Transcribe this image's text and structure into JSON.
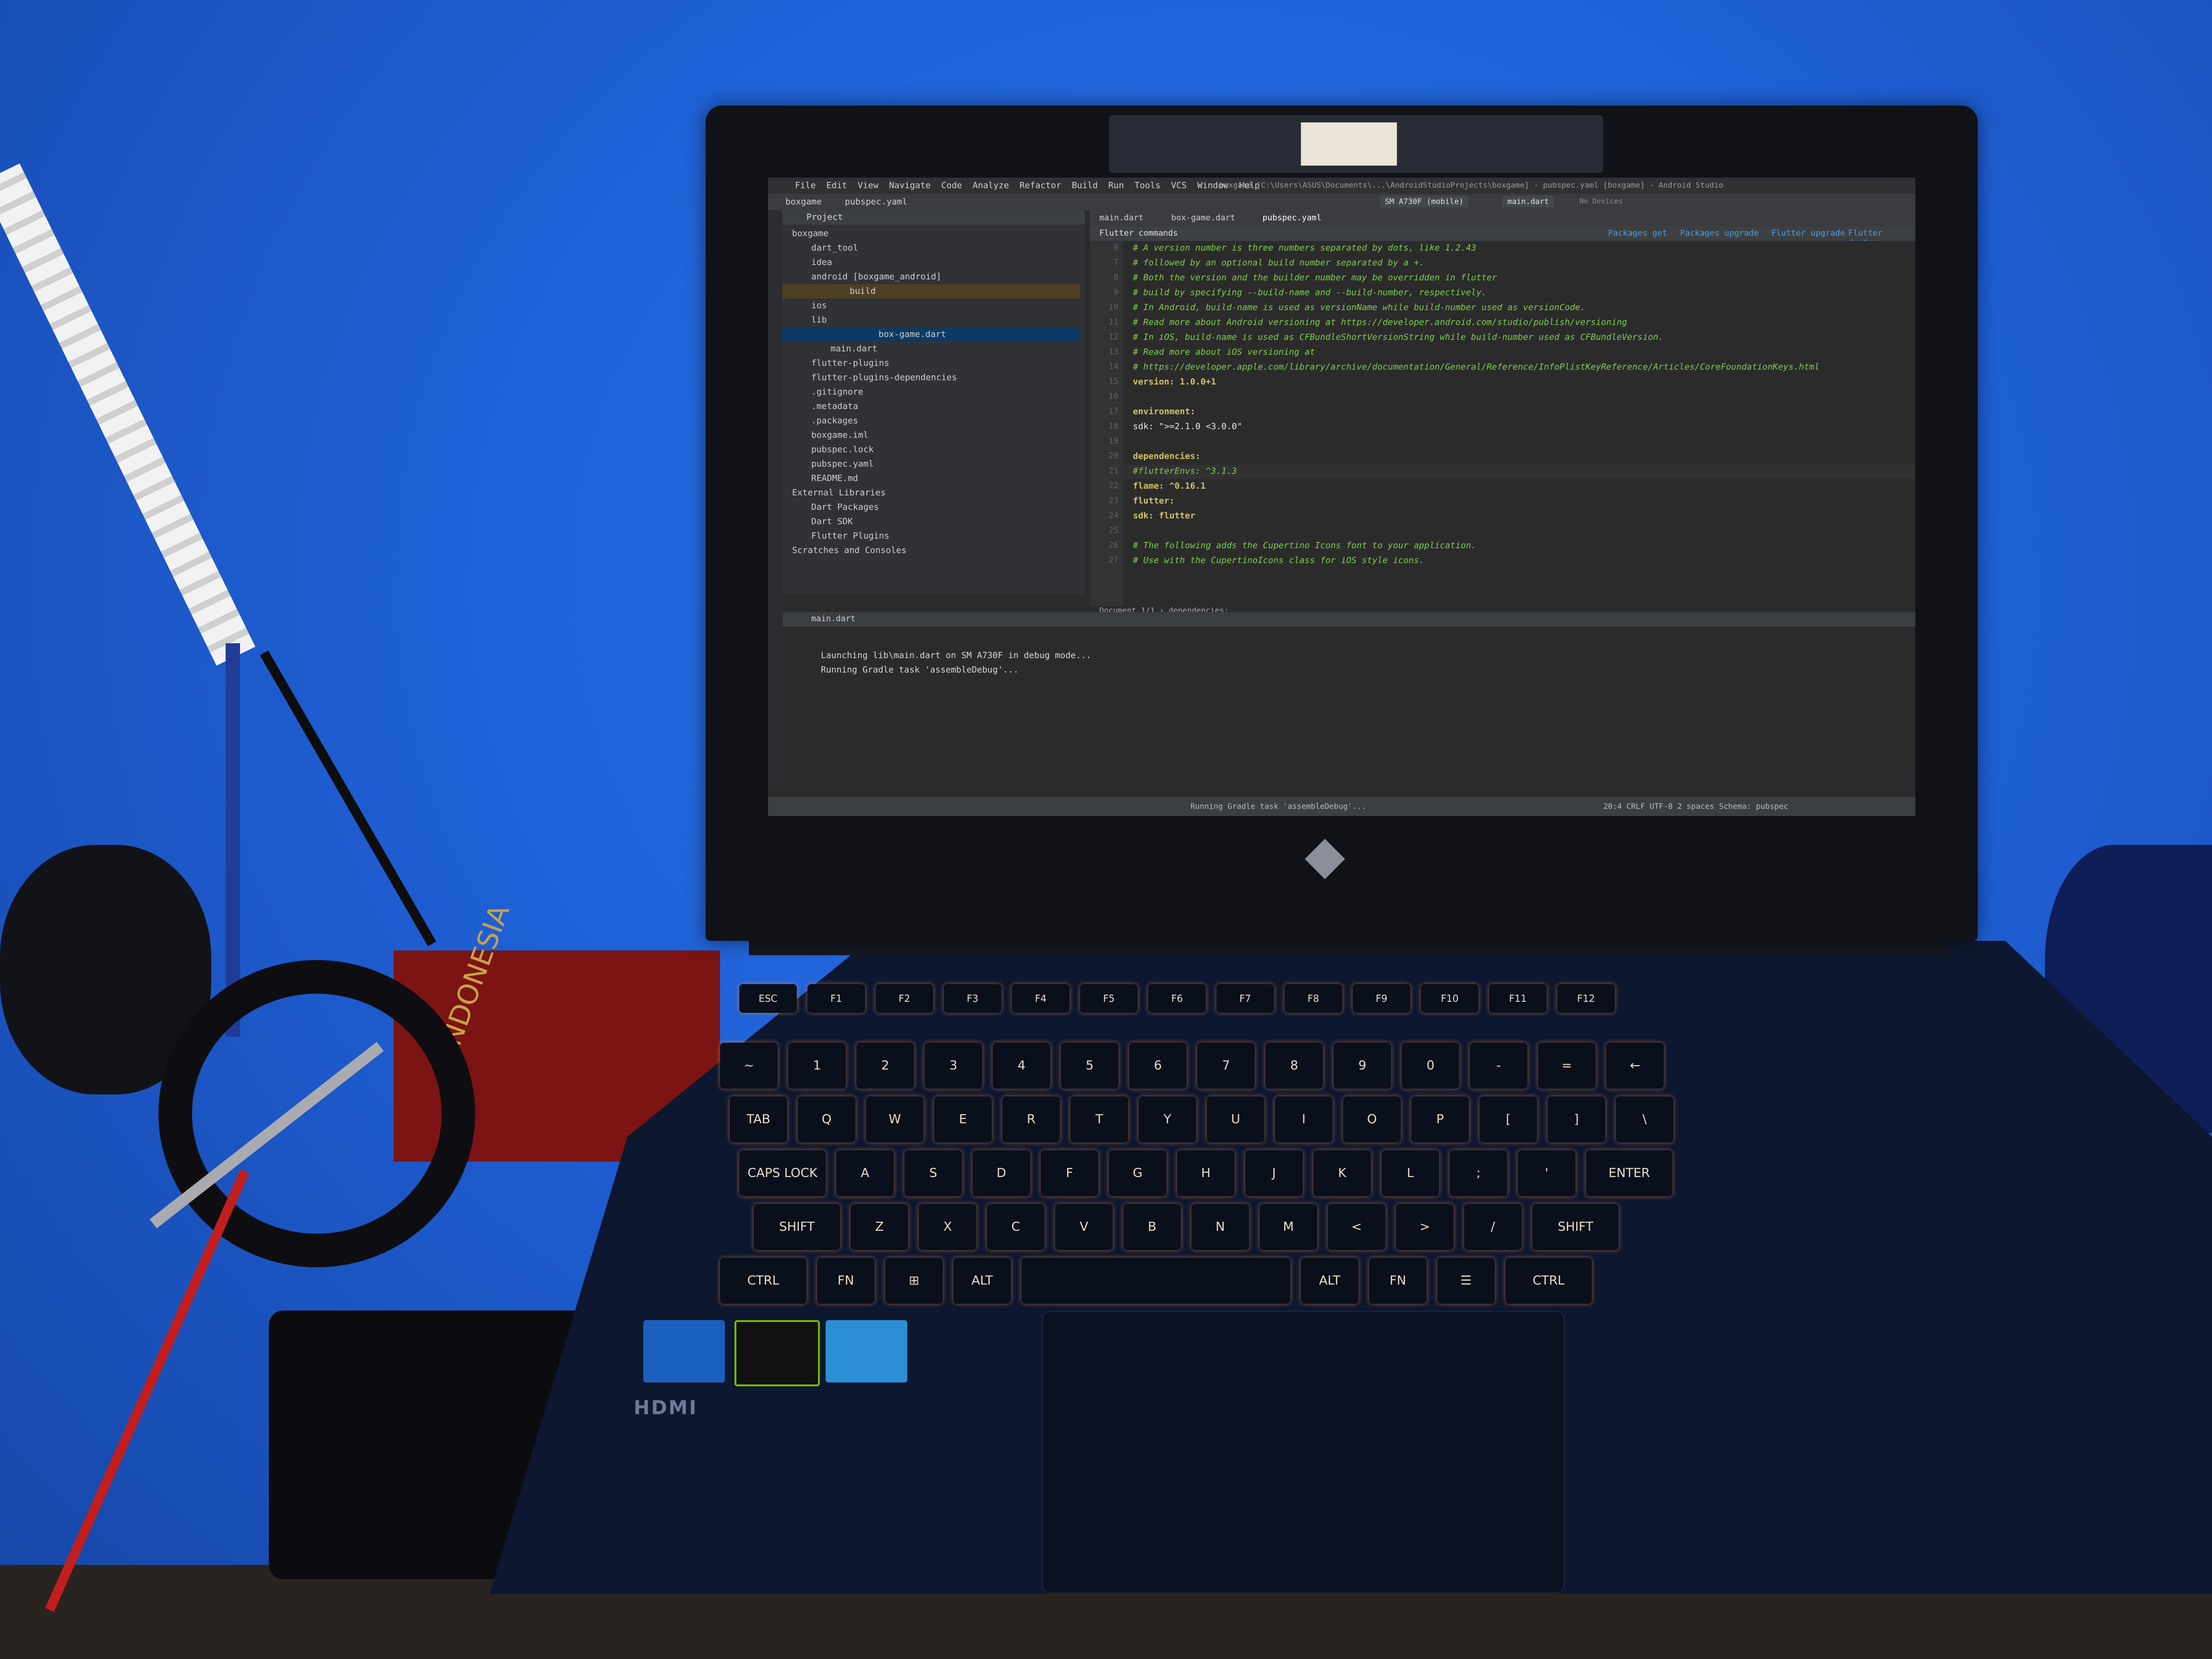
{
  "ide": {
    "menu": [
      "File",
      "Edit",
      "View",
      "Navigate",
      "Code",
      "Analyze",
      "Refactor",
      "Build",
      "Run",
      "Tools",
      "VCS",
      "Window",
      "Help"
    ],
    "window_title": "boxgame [C:\\Users\\ASUS\\Documents\\...\\AndroidStudioProjects\\boxgame] - pubspec.yaml [boxgame] - Android Studio",
    "breadcrumb_project": "boxgame",
    "breadcrumb_file": "pubspec.yaml",
    "device": "SM A730F (mobile)",
    "run_config": "main.dart",
    "no_devices": "No Devices",
    "project_header": "Project",
    "tree": [
      "boxgame",
      "dart_tool",
      "idea",
      "android [boxgame_android]",
      "build",
      "ios",
      "lib",
      "box-game.dart",
      "main.dart",
      "flutter-plugins",
      "flutter-plugins-dependencies",
      ".gitignore",
      ".metadata",
      ".packages",
      "boxgame.iml",
      "pubspec.lock",
      "pubspec.yaml",
      "README.md",
      "External Libraries",
      "Dart Packages",
      "Dart SDK",
      "Flutter Plugins",
      "Scratches and Consoles"
    ],
    "tabs": [
      "main.dart",
      "box-game.dart",
      "pubspec.yaml"
    ],
    "flutter_commands_title": "Flutter commands",
    "flutter_links": [
      "Packages get",
      "Packages upgrade",
      "Flutter upgrade",
      "Flutter doctor"
    ],
    "code_lines": [
      {
        "n": "6",
        "t": "# A version number is three numbers separated by dots, like 1.2.43",
        "k": "c"
      },
      {
        "n": "7",
        "t": "# followed by an optional build number separated by a +.",
        "k": "c"
      },
      {
        "n": "8",
        "t": "# Both the version and the builder number may be overridden in flutter",
        "k": "c"
      },
      {
        "n": "9",
        "t": "# build by specifying --build-name and --build-number, respectively.",
        "k": "c"
      },
      {
        "n": "10",
        "t": "# In Android, build-name is used as versionName while build-number used as versionCode.",
        "k": "c"
      },
      {
        "n": "11",
        "t": "# Read more about Android versioning at https://developer.android.com/studio/publish/versioning",
        "k": "c"
      },
      {
        "n": "12",
        "t": "# In iOS, build-name is used as CFBundleShortVersionString while build-number used as CFBundleVersion.",
        "k": "c"
      },
      {
        "n": "13",
        "t": "# Read more about iOS versioning at",
        "k": "c"
      },
      {
        "n": "14",
        "t": "# https://developer.apple.com/library/archive/documentation/General/Reference/InfoPlistKeyReference/Articles/CoreFoundationKeys.html",
        "k": "c"
      },
      {
        "n": "15",
        "t": "version: 1.0.0+1",
        "k": "k"
      },
      {
        "n": "16",
        "t": "",
        "k": "v"
      },
      {
        "n": "17",
        "t": "environment:",
        "k": "k"
      },
      {
        "n": "18",
        "t": "  sdk: \">=2.1.0 <3.0.0\"",
        "k": "v"
      },
      {
        "n": "19",
        "t": "",
        "k": "v"
      },
      {
        "n": "20",
        "t": "dependencies:",
        "k": "k"
      },
      {
        "n": "21",
        "t": "  #flutterEnvs: ^3.1.3",
        "k": "c"
      },
      {
        "n": "22",
        "t": "  flame: ^0.16.1",
        "k": "k"
      },
      {
        "n": "23",
        "t": "  flutter:",
        "k": "k"
      },
      {
        "n": "24",
        "t": "    sdk: flutter",
        "k": "k"
      },
      {
        "n": "25",
        "t": "",
        "k": "v"
      },
      {
        "n": "26",
        "t": "  # The following adds the Cupertino Icons font to your application.",
        "k": "c"
      },
      {
        "n": "27",
        "t": "  # Use with the CupertinoIcons class for iOS style icons.",
        "k": "c"
      }
    ],
    "editor_breadcrumb": "Document 1/1  ›  dependencies:",
    "run_tab": "main.dart",
    "console_lines": [
      "Launching lib\\main.dart on SM A730F in debug mode...",
      "Running Gradle task 'assembleDebug'..."
    ],
    "status_message": "Running Gradle task 'assembleDebug'...",
    "status_right": "20:4   CRLF   UTF-8   2 spaces   Schema: pubspec"
  },
  "laptop": {
    "hdmi": "HDMI",
    "keys_row1": [
      "ESC",
      "F1",
      "F2",
      "F3",
      "F4",
      "F5",
      "F6",
      "F7",
      "F8",
      "F9",
      "F10",
      "F11",
      "F12"
    ],
    "keys_row2": [
      "~",
      "1",
      "2",
      "3",
      "4",
      "5",
      "6",
      "7",
      "8",
      "9",
      "0",
      "-",
      "=",
      "←"
    ],
    "keys_row3": [
      "TAB",
      "Q",
      "W",
      "E",
      "R",
      "T",
      "Y",
      "U",
      "I",
      "O",
      "P",
      "[",
      "]",
      "\\"
    ],
    "keys_row4": [
      "CAPS LOCK",
      "A",
      "S",
      "D",
      "F",
      "G",
      "H",
      "J",
      "K",
      "L",
      ";",
      "'",
      "ENTER"
    ],
    "keys_row5": [
      "SHIFT",
      "Z",
      "X",
      "C",
      "V",
      "B",
      "N",
      "M",
      "<",
      ">",
      "/",
      "SHIFT"
    ],
    "keys_row6": [
      "CTRL",
      "FN",
      "⊞",
      "ALT",
      "",
      "ALT",
      "FN",
      "☰",
      "CTRL"
    ]
  },
  "desk": {
    "box_text": "INDONESIA"
  },
  "colors": {
    "wall": "#1f63d8",
    "key_glow": "#ff9640",
    "ide_bg": "#2b2b2b",
    "comment": "#7ccf4e",
    "key": "#d1c16a"
  }
}
